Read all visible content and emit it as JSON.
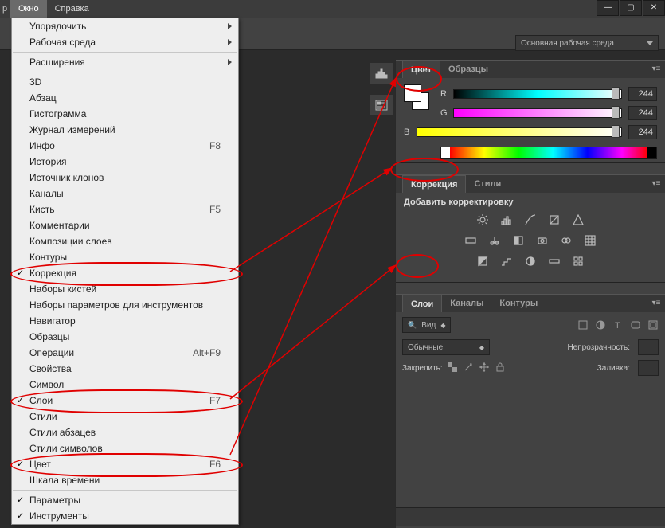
{
  "menubar": {
    "truncated_left": "р",
    "items": [
      "Окно",
      "Справка"
    ],
    "active_index": 0
  },
  "window_controls": {
    "min": "—",
    "max": "▢",
    "close": "✕"
  },
  "workspace_selector": {
    "label": "Основная рабочая среда"
  },
  "window_menu": {
    "groups": [
      [
        {
          "label": "Упорядочить",
          "submenu": true
        },
        {
          "label": "Рабочая среда",
          "submenu": true
        }
      ],
      [
        {
          "label": "Расширения",
          "submenu": true
        }
      ],
      [
        {
          "label": "3D"
        },
        {
          "label": "Абзац"
        },
        {
          "label": "Гистограмма"
        },
        {
          "label": "Журнал измерений"
        },
        {
          "label": "Инфо",
          "accel": "F8"
        },
        {
          "label": "История"
        },
        {
          "label": "Источник клонов"
        },
        {
          "label": "Каналы"
        },
        {
          "label": "Кисть",
          "accel": "F5"
        },
        {
          "label": "Комментарии"
        },
        {
          "label": "Композиции слоев"
        },
        {
          "label": "Контуры"
        },
        {
          "label": "Коррекция",
          "checked": true,
          "highlight": true
        },
        {
          "label": "Наборы кистей"
        },
        {
          "label": "Наборы параметров для инструментов"
        },
        {
          "label": "Навигатор"
        },
        {
          "label": "Образцы"
        },
        {
          "label": "Операции",
          "accel": "Alt+F9"
        },
        {
          "label": "Свойства"
        },
        {
          "label": "Символ"
        },
        {
          "label": "Слои",
          "accel": "F7",
          "checked": true,
          "highlight": true
        },
        {
          "label": "Стили"
        },
        {
          "label": "Стили абзацев"
        },
        {
          "label": "Стили символов"
        },
        {
          "label": "Цвет",
          "accel": "F6",
          "checked": true,
          "highlight": true
        },
        {
          "label": "Шкала времени"
        }
      ],
      [
        {
          "label": "Параметры",
          "checked": true
        },
        {
          "label": "Инструменты",
          "checked": true
        }
      ]
    ]
  },
  "panel_color": {
    "tabs": [
      "Цвет",
      "Образцы"
    ],
    "active_tab": 0,
    "channels": [
      {
        "id": "R",
        "value": 244,
        "gradient": "linear-gradient(90deg,#000,#00ffff,#fff)"
      },
      {
        "id": "G",
        "value": 244,
        "gradient": "linear-gradient(90deg,#ff00ff,#fff)"
      },
      {
        "id": "B",
        "value": 244,
        "gradient": "linear-gradient(90deg,#ffff00,#fff)"
      }
    ]
  },
  "panel_adjustments": {
    "tabs": [
      "Коррекция",
      "Стили"
    ],
    "active_tab": 0,
    "heading": "Добавить корректировку"
  },
  "panel_layers": {
    "tabs": [
      "Слои",
      "Каналы",
      "Контуры"
    ],
    "active_tab": 0,
    "kind_label": "Вид",
    "blend_mode": "Обычные",
    "opacity_label": "Непрозрачность:",
    "lock_label": "Закрепить:",
    "fill_label": "Заливка:"
  }
}
